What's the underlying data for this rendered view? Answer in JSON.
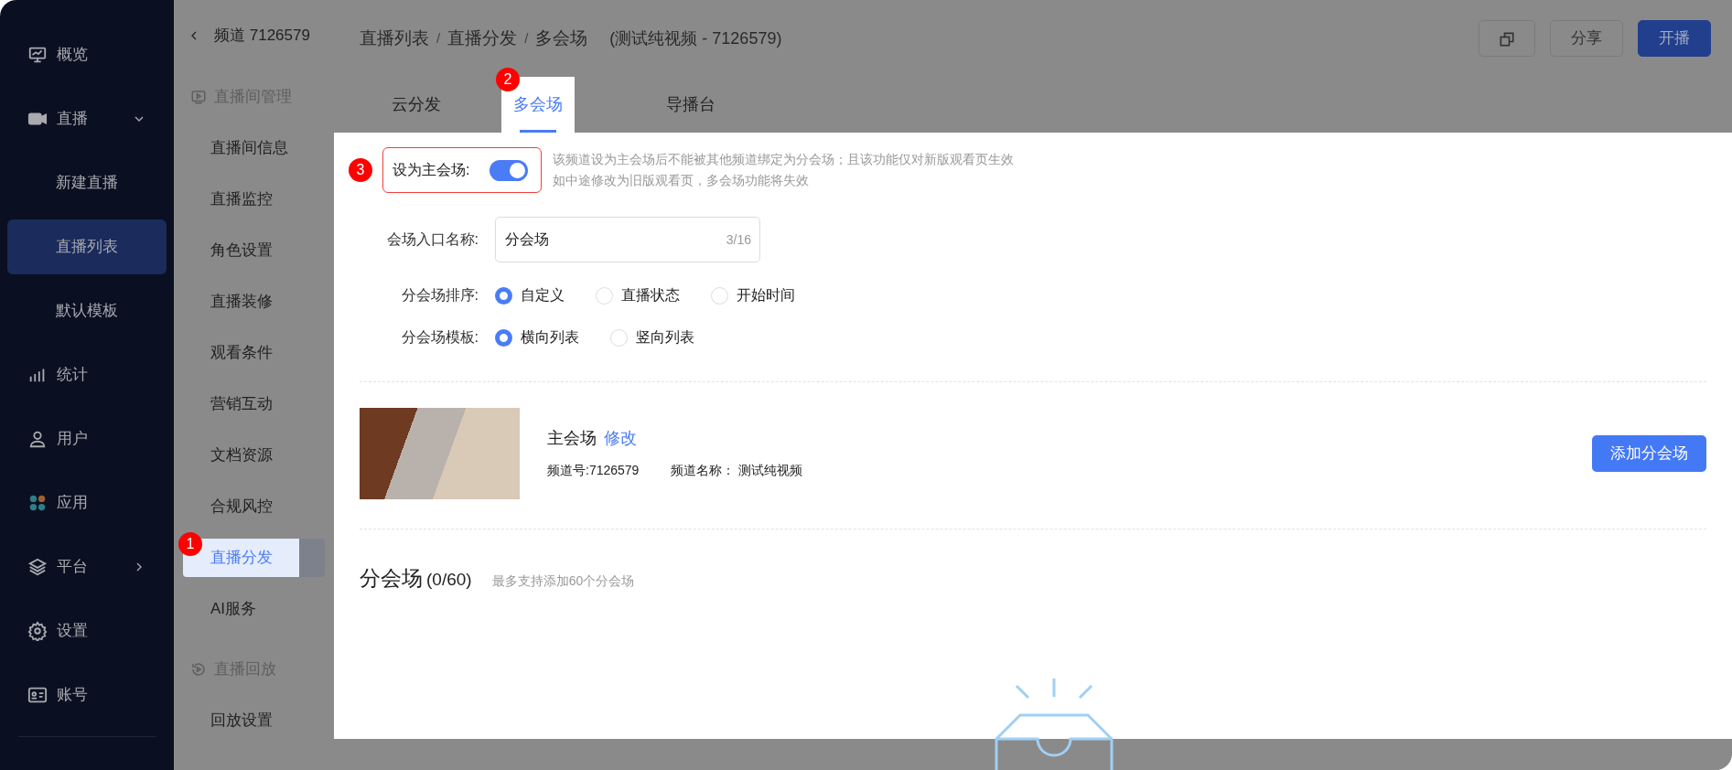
{
  "nav": {
    "items": [
      {
        "label": "概览",
        "kind": "link",
        "selected": false
      },
      {
        "label": "直播",
        "kind": "group",
        "selected": false,
        "expanded": true,
        "children": [
          {
            "label": "新建直播",
            "selected": false
          },
          {
            "label": "直播列表",
            "selected": true
          },
          {
            "label": "默认模板",
            "selected": false
          }
        ]
      },
      {
        "label": "统计",
        "kind": "link",
        "selected": false
      },
      {
        "label": "用户",
        "kind": "link",
        "selected": false
      },
      {
        "label": "应用",
        "kind": "link",
        "selected": false
      },
      {
        "label": "平台",
        "kind": "group",
        "selected": false,
        "expanded": false
      },
      {
        "label": "设置",
        "kind": "link",
        "selected": false
      },
      {
        "label": "账号",
        "kind": "link",
        "selected": false
      }
    ]
  },
  "channel_menu": {
    "back_title": "频道 7126579",
    "sections": [
      {
        "title": "直播间管理",
        "items": [
          {
            "label": "直播间信息",
            "selected": false
          },
          {
            "label": "直播监控",
            "selected": false
          },
          {
            "label": "角色设置",
            "selected": false
          },
          {
            "label": "直播装修",
            "selected": false
          },
          {
            "label": "观看条件",
            "selected": false
          },
          {
            "label": "营销互动",
            "selected": false
          },
          {
            "label": "文档资源",
            "selected": false
          },
          {
            "label": "合规风控",
            "selected": false
          },
          {
            "label": "直播分发",
            "selected": true,
            "step": "1"
          },
          {
            "label": "AI服务",
            "selected": false
          }
        ]
      },
      {
        "title": "直播回放",
        "items": [
          {
            "label": "回放设置",
            "selected": false
          }
        ]
      }
    ]
  },
  "header": {
    "breadcrumb": [
      "直播列表",
      "直播分发",
      "多会场"
    ],
    "separators": [
      "/",
      "/"
    ],
    "subtitle": "(测试纯视频 - 7126579)",
    "buttons": [
      {
        "kind": "icon"
      },
      {
        "kind": "default",
        "label": "分享"
      },
      {
        "kind": "primary",
        "label": "开播"
      }
    ]
  },
  "tabs": [
    {
      "label": "云分发",
      "selected": false
    },
    {
      "label": "多会场",
      "selected": true,
      "step": "2"
    },
    {
      "label": "导播台",
      "selected": false
    }
  ],
  "form": {
    "main_toggle": {
      "label": "设为主会场:",
      "on": true,
      "step": "3",
      "hints": [
        "该频道设为主会场后不能被其他频道绑定为分会场；且该功能仅对新版观看页生效",
        "如中途修改为旧版观看页，多会场功能将失效"
      ]
    },
    "entry_name": {
      "label": "会场入口名称:",
      "value": "分会场",
      "counter": "3/16"
    },
    "radio_groups": [
      {
        "label": "分会场排序:",
        "options": [
          {
            "label": "自定义",
            "selected": true
          },
          {
            "label": "直播状态",
            "selected": false
          },
          {
            "label": "开始时间",
            "selected": false
          }
        ]
      },
      {
        "label": "分会场模板:",
        "options": [
          {
            "label": "横向列表",
            "selected": true
          },
          {
            "label": "竖向列表",
            "selected": false
          }
        ]
      }
    ]
  },
  "main_venue": {
    "title": "主会场",
    "edit_link": "修改",
    "channel_no": "频道号:7126579",
    "channel_name": "频道名称： 测试纯视频",
    "add_button": "添加分会场"
  },
  "sub_venues": {
    "title": "分会场",
    "count": "(0/60)",
    "note": "最多支持添加60个分会场"
  }
}
